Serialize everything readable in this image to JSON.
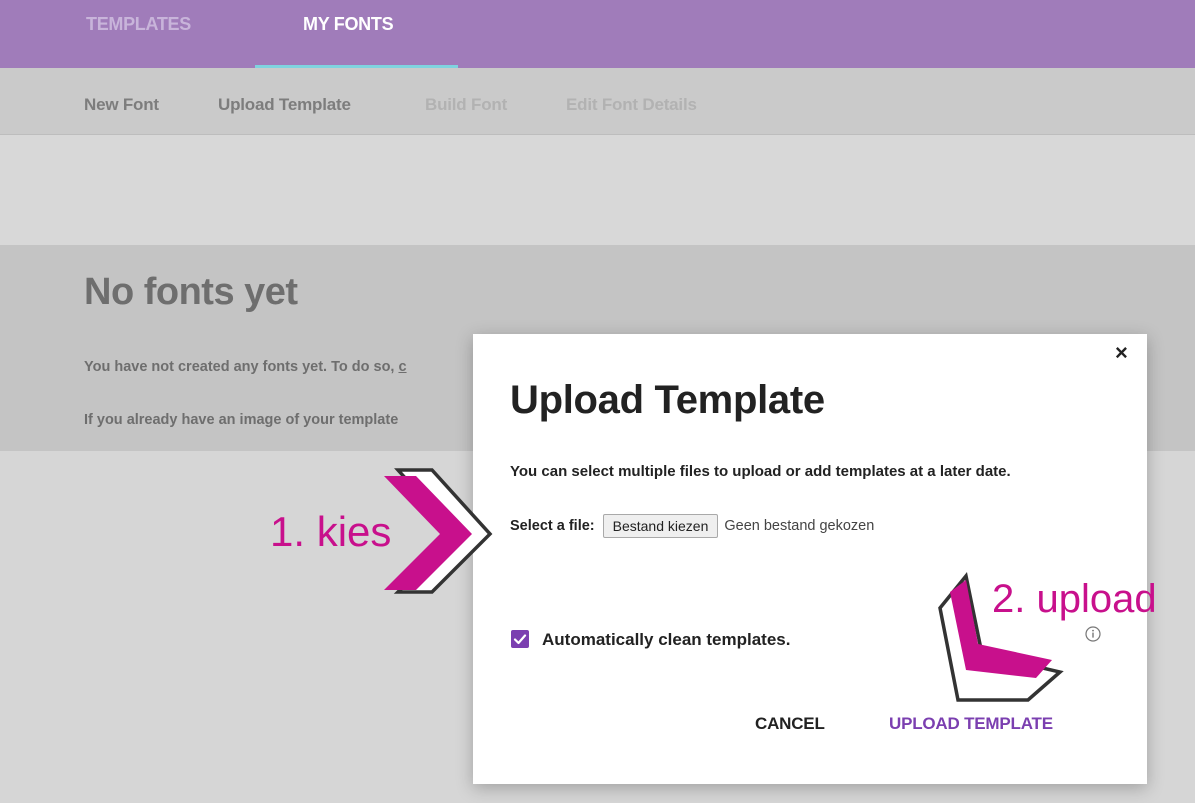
{
  "top_tabs": [
    {
      "label": "TEMPLATES"
    },
    {
      "label": "MY FONTS"
    }
  ],
  "subnav": [
    {
      "label": "New Font"
    },
    {
      "label": "Upload Template"
    },
    {
      "label": "Build Font"
    },
    {
      "label": "Edit Font Details"
    }
  ],
  "panel": {
    "title": "No fonts yet",
    "line1": "You have not created any fonts yet. To do so, ",
    "line1_link": "c",
    "line2": "If you already have an image of your template"
  },
  "dialog": {
    "close": "×",
    "title": "Upload Template",
    "description": "You can select multiple files to upload or add templates at a later date.",
    "file_label": "Select a file:",
    "file_button": "Bestand kiezen",
    "file_status": "Geen bestand gekozen",
    "checkbox_label": "Automatically clean templates.",
    "checkbox_checked": true,
    "cancel": "CANCEL",
    "upload": "UPLOAD TEMPLATE"
  },
  "annotations": {
    "step1": "1. kies",
    "step2": "2. upload"
  },
  "colors": {
    "topbar": "#a07cba",
    "accent": "#7b3fb0",
    "annotation": "#c8108c",
    "tab_indicator": "#7fd3df"
  },
  "icons": [
    "close-icon",
    "check-icon",
    "info-icon",
    "chevron-right-arrow-icon",
    "chevron-down-left-arrow-icon"
  ]
}
